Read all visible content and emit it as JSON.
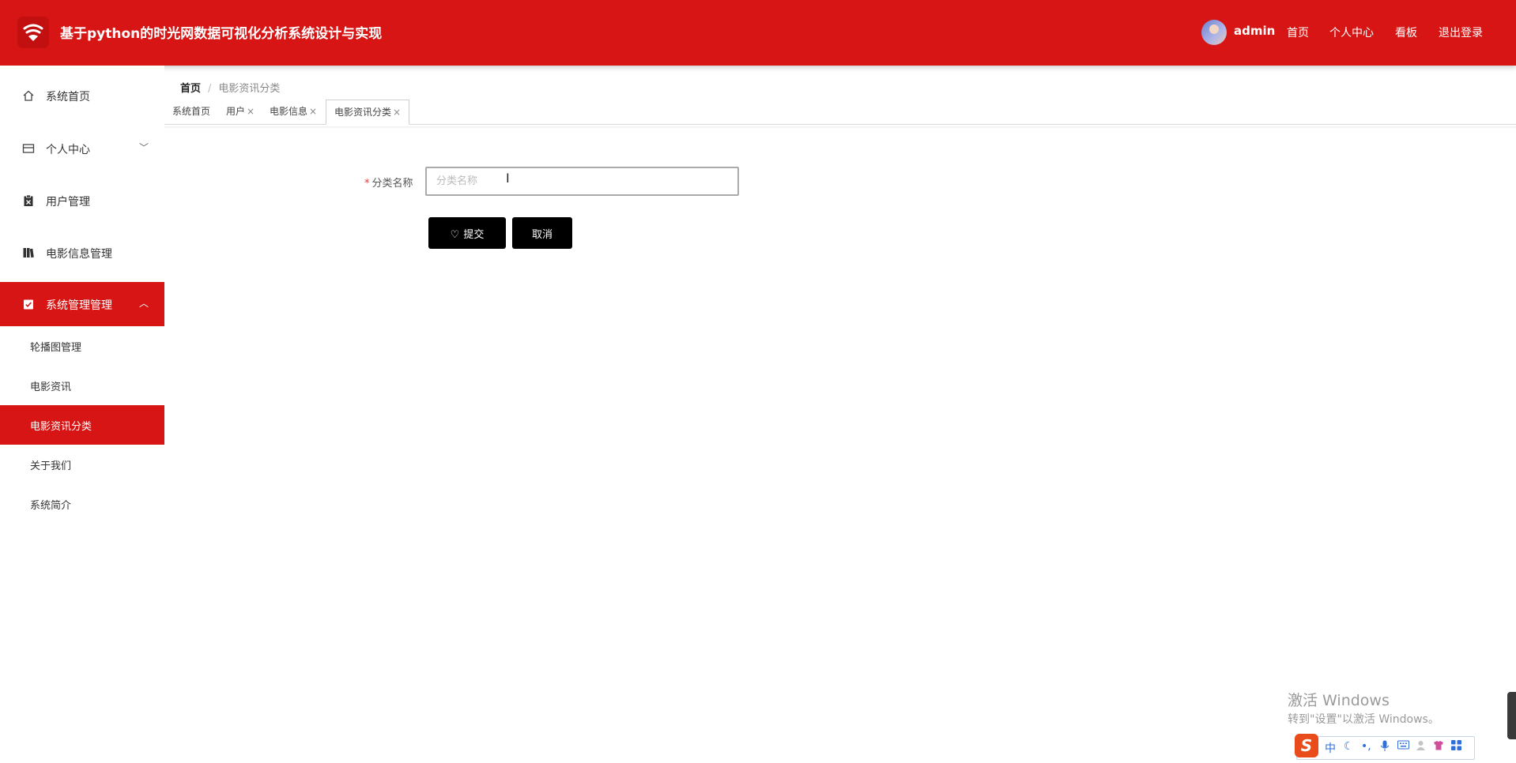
{
  "header": {
    "title": "基于python的时光网数据可视化分析系统设计与实现",
    "username": "admin",
    "nav": [
      "首页",
      "个人中心",
      "看板",
      "退出登录"
    ],
    "accent_color": "#d71515"
  },
  "sidebar": {
    "items": [
      {
        "label": "系统首页",
        "icon": "home-icon"
      },
      {
        "label": "个人中心",
        "icon": "card-icon",
        "arrow": "﹀"
      },
      {
        "label": "用户管理",
        "icon": "clipboard-icon"
      },
      {
        "label": "电影信息管理",
        "icon": "book-icon"
      },
      {
        "label": "系统管理管理",
        "icon": "checklist-icon",
        "arrow": "︿"
      }
    ],
    "submenu": [
      "轮播图管理",
      "电影资讯",
      "电影资讯分类",
      "关于我们",
      "系统简介"
    ]
  },
  "breadcrumb": {
    "home": "首页",
    "separator": "/",
    "current": "电影资讯分类"
  },
  "tabs": {
    "items": [
      {
        "label": "系统首页"
      },
      {
        "label": "用户",
        "close": "×"
      },
      {
        "label": "电影信息",
        "close": "×"
      },
      {
        "label": "电影资讯分类",
        "close": "×"
      }
    ]
  },
  "form": {
    "required_mark": "*",
    "category_label": "分类名称",
    "category_value": "",
    "category_placeholder": "分类名称",
    "submit_label": "提交",
    "cancel_label": "取消"
  },
  "watermark": {
    "title": "激活 Windows",
    "subtitle": "转到\"设置\"以激活 Windows。"
  },
  "ime": {
    "logo": "S",
    "mode": "中"
  }
}
